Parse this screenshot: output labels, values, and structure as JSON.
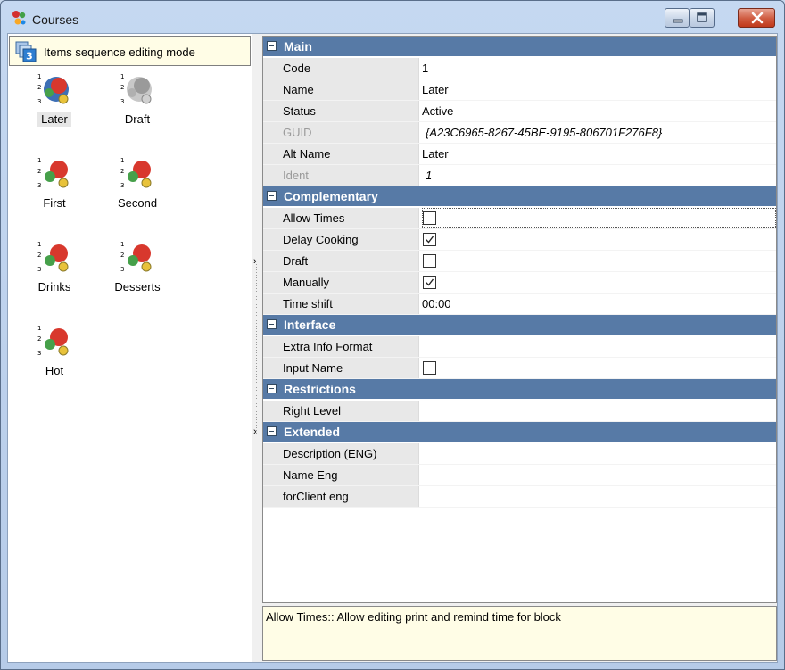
{
  "window": {
    "title": "Courses",
    "app_icon": "courses-app-icon",
    "buttons": {
      "minimize": "minimize-icon",
      "maximize": "maximize-icon",
      "close": "close-icon"
    }
  },
  "left_panel": {
    "mode_banner": "Items sequence editing mode",
    "mode_icon": "sequence-mode-icon",
    "courses": [
      {
        "label": "Later",
        "status": "active",
        "selected": true
      },
      {
        "label": "Draft",
        "status": "inactive",
        "selected": false
      },
      {
        "label": "First",
        "status": "active",
        "selected": false
      },
      {
        "label": "Second",
        "status": "active",
        "selected": false
      },
      {
        "label": "Drinks",
        "status": "active",
        "selected": false
      },
      {
        "label": "Desserts",
        "status": "active",
        "selected": false
      },
      {
        "label": "Hot",
        "status": "active",
        "selected": false
      }
    ]
  },
  "properties": {
    "main": {
      "label": "Main",
      "code": {
        "name": "Code",
        "value": "1"
      },
      "name": {
        "name": "Name",
        "value": "Later"
      },
      "status": {
        "name": "Status",
        "value": "Active"
      },
      "guid": {
        "name": "GUID",
        "value": "{A23C6965-8267-45BE-9195-806701F276F8}"
      },
      "alt_name": {
        "name": "Alt Name",
        "value": "Later"
      },
      "ident": {
        "name": "Ident",
        "value": "1"
      }
    },
    "complementary": {
      "label": "Complementary",
      "allow_times": {
        "name": "Allow Times",
        "checked": false
      },
      "delay_cooking": {
        "name": "Delay Cooking",
        "checked": true
      },
      "draft": {
        "name": "Draft",
        "checked": false
      },
      "manually": {
        "name": "Manually",
        "checked": true
      },
      "time_shift": {
        "name": "Time shift",
        "value": "00:00"
      }
    },
    "interface": {
      "label": "Interface",
      "extra_info_format": {
        "name": "Extra Info Format",
        "value": ""
      },
      "input_name": {
        "name": "Input Name",
        "checked": false
      }
    },
    "restrictions": {
      "label": "Restrictions",
      "right_level": {
        "name": "Right Level",
        "value": ""
      }
    },
    "extended": {
      "label": "Extended",
      "description_eng": {
        "name": "Description (ENG)",
        "value": ""
      },
      "name_eng": {
        "name": "Name Eng",
        "value": ""
      },
      "forclient_eng": {
        "name": "forClient eng",
        "value": ""
      }
    }
  },
  "help": {
    "text": "Allow Times:: Allow editing print and remind time for block"
  },
  "colors": {
    "category_header": "#577aa6",
    "property_name_bg": "#e8e8e8",
    "banner_bg": "#fffde6"
  }
}
